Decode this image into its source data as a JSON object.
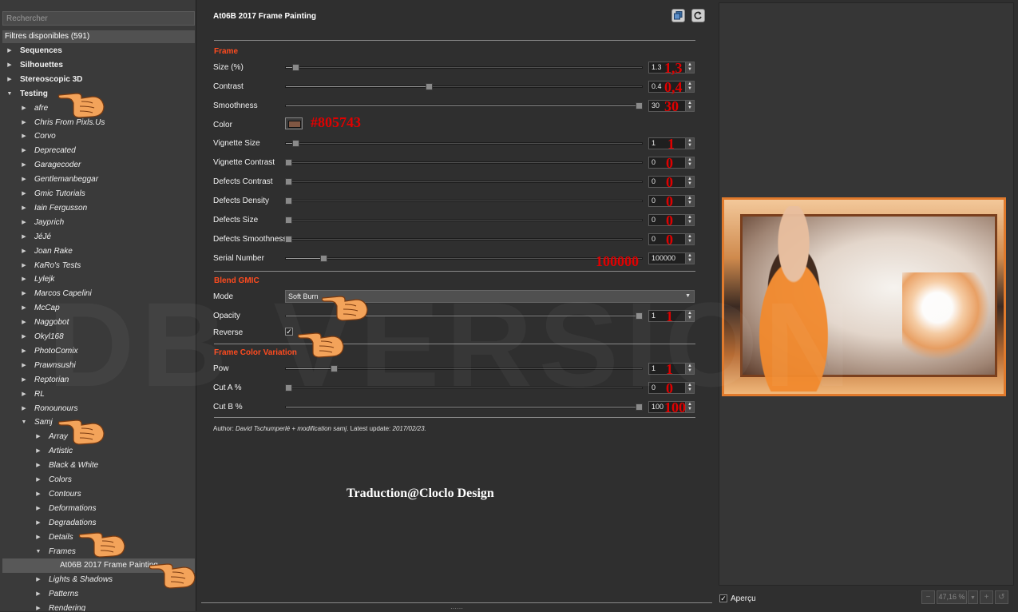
{
  "search": {
    "placeholder": "Rechercher"
  },
  "filters_header": "Filtres disponibles (591)",
  "tree": [
    {
      "label": "Sequences",
      "style": "bold",
      "level": 0,
      "arrow": "right"
    },
    {
      "label": "Silhouettes",
      "style": "bold",
      "level": 0,
      "arrow": "right"
    },
    {
      "label": "Stereoscopic 3D",
      "style": "bold",
      "level": 0,
      "arrow": "right"
    },
    {
      "label": "Testing",
      "style": "bold",
      "level": 0,
      "arrow": "down"
    },
    {
      "label": "afre",
      "style": "ital",
      "level": 1,
      "arrow": "right"
    },
    {
      "label": "Chris From Pixls.Us",
      "style": "ital",
      "level": 1,
      "arrow": "right"
    },
    {
      "label": "Corvo",
      "style": "ital",
      "level": 1,
      "arrow": "right"
    },
    {
      "label": "Deprecated",
      "style": "ital",
      "level": 1,
      "arrow": "right"
    },
    {
      "label": "Garagecoder",
      "style": "ital",
      "level": 1,
      "arrow": "right"
    },
    {
      "label": "Gentlemanbeggar",
      "style": "ital",
      "level": 1,
      "arrow": "right"
    },
    {
      "label": "Gmic Tutorials",
      "style": "ital",
      "level": 1,
      "arrow": "right"
    },
    {
      "label": "Iain Fergusson",
      "style": "ital",
      "level": 1,
      "arrow": "right"
    },
    {
      "label": "Jayprich",
      "style": "ital",
      "level": 1,
      "arrow": "right"
    },
    {
      "label": "JéJé",
      "style": "ital",
      "level": 1,
      "arrow": "right"
    },
    {
      "label": "Joan Rake",
      "style": "ital",
      "level": 1,
      "arrow": "right"
    },
    {
      "label": "KaRo's Tests",
      "style": "ital",
      "level": 1,
      "arrow": "right"
    },
    {
      "label": "Lylejk",
      "style": "ital",
      "level": 1,
      "arrow": "right"
    },
    {
      "label": "Marcos Capelini",
      "style": "ital",
      "level": 1,
      "arrow": "right"
    },
    {
      "label": "McCap",
      "style": "ital",
      "level": 1,
      "arrow": "right"
    },
    {
      "label": "Naggobot",
      "style": "ital",
      "level": 1,
      "arrow": "right"
    },
    {
      "label": "Okyl168",
      "style": "ital",
      "level": 1,
      "arrow": "right"
    },
    {
      "label": "PhotoComix",
      "style": "ital",
      "level": 1,
      "arrow": "right"
    },
    {
      "label": "Prawnsushi",
      "style": "ital",
      "level": 1,
      "arrow": "right"
    },
    {
      "label": "Reptorian",
      "style": "ital",
      "level": 1,
      "arrow": "right"
    },
    {
      "label": "RL",
      "style": "ital",
      "level": 1,
      "arrow": "right"
    },
    {
      "label": "Ronounours",
      "style": "ital",
      "level": 1,
      "arrow": "right"
    },
    {
      "label": "Samj",
      "style": "ital",
      "level": 1,
      "arrow": "down"
    },
    {
      "label": "Array",
      "style": "ital",
      "level": 2,
      "arrow": "right"
    },
    {
      "label": "Artistic",
      "style": "ital",
      "level": 2,
      "arrow": "right"
    },
    {
      "label": "Black & White",
      "style": "ital",
      "level": 2,
      "arrow": "right"
    },
    {
      "label": "Colors",
      "style": "ital",
      "level": 2,
      "arrow": "right"
    },
    {
      "label": "Contours",
      "style": "ital",
      "level": 2,
      "arrow": "right"
    },
    {
      "label": "Deformations",
      "style": "ital",
      "level": 2,
      "arrow": "right"
    },
    {
      "label": "Degradations",
      "style": "ital",
      "level": 2,
      "arrow": "right"
    },
    {
      "label": "Details",
      "style": "ital",
      "level": 2,
      "arrow": "right"
    },
    {
      "label": "Frames",
      "style": "ital",
      "level": 2,
      "arrow": "down"
    },
    {
      "label": "At06B 2017 Frame Painting",
      "style": "plain",
      "level": 3,
      "arrow": "none",
      "selected": true
    },
    {
      "label": "Lights & Shadows",
      "style": "ital",
      "level": 2,
      "arrow": "right"
    },
    {
      "label": "Patterns",
      "style": "ital",
      "level": 2,
      "arrow": "right"
    },
    {
      "label": "Rendering",
      "style": "ital",
      "level": 2,
      "arrow": "right"
    }
  ],
  "filter": {
    "title": "At06B 2017 Frame Painting",
    "sections": {
      "frame": "Frame",
      "blend": "Blend GMIC",
      "variation": "Frame Color Variation"
    },
    "params": {
      "size": {
        "label": "Size (%)",
        "value": "1.3",
        "fraction": 0.02,
        "annot": "1,3"
      },
      "contrast": {
        "label": "Contrast",
        "value": "0.4",
        "fraction": 0.4,
        "annot": "0,4"
      },
      "smoothness": {
        "label": "Smoothness",
        "value": "30",
        "fraction": 1.0,
        "annot": "30"
      },
      "color": {
        "label": "Color",
        "value": "#805743",
        "annot": "#805743"
      },
      "vignette_size": {
        "label": "Vignette Size",
        "value": "1",
        "fraction": 0.02,
        "annot": "1"
      },
      "vignette_contrast": {
        "label": "Vignette Contrast",
        "value": "0",
        "fraction": 0,
        "annot": "0"
      },
      "defects_contrast": {
        "label": "Defects Contrast",
        "value": "0",
        "fraction": 0,
        "annot": "0"
      },
      "defects_density": {
        "label": "Defects Density",
        "value": "0",
        "fraction": 0,
        "annot": "0"
      },
      "defects_size": {
        "label": "Defects Size",
        "value": "0",
        "fraction": 0,
        "annot": "0"
      },
      "defects_smoothness": {
        "label": "Defects Smoothness",
        "value": "0",
        "fraction": 0,
        "annot": "0"
      },
      "serial_number": {
        "label": "Serial Number",
        "value": "100000",
        "fraction": 0.1,
        "annot": "100000"
      },
      "mode": {
        "label": "Mode",
        "value": "Soft Burn"
      },
      "opacity": {
        "label": "Opacity",
        "value": "1",
        "fraction": 1.0,
        "annot": "1"
      },
      "reverse": {
        "label": "Reverse",
        "checked": true,
        "check_glyph": "✓"
      },
      "pow": {
        "label": "Pow",
        "value": "1",
        "fraction": 0.13,
        "annot": "1"
      },
      "cut_a": {
        "label": "Cut A %",
        "value": "0",
        "fraction": 0,
        "annot": "0"
      },
      "cut_b": {
        "label": "Cut B %",
        "value": "100",
        "fraction": 1.0,
        "annot": "100"
      }
    },
    "author_prefix": "Author: ",
    "author_name": "David Tschumperlé + modification samj",
    "updated_prefix": ". Latest update: ",
    "updated_date": "2017/02/23."
  },
  "credit": "Traduction@Cloclo Design",
  "watermark": "DB VERSION",
  "preview": {
    "apercu_label": "Aperçu",
    "apercu_checked": true,
    "zoom": "47,16 %"
  },
  "colors": {
    "accent_section": "#ff4b1f",
    "annotation_red": "#e00000",
    "frame_color": "#805743",
    "hand_orange": "#f3a35a"
  },
  "icons": {
    "top_buttons": [
      "copy-icon",
      "refresh-icon"
    ],
    "zoom_buttons": [
      "zoom-out-icon",
      "zoom-dropdown-icon",
      "zoom-in-icon",
      "reset-zoom-icon"
    ]
  }
}
